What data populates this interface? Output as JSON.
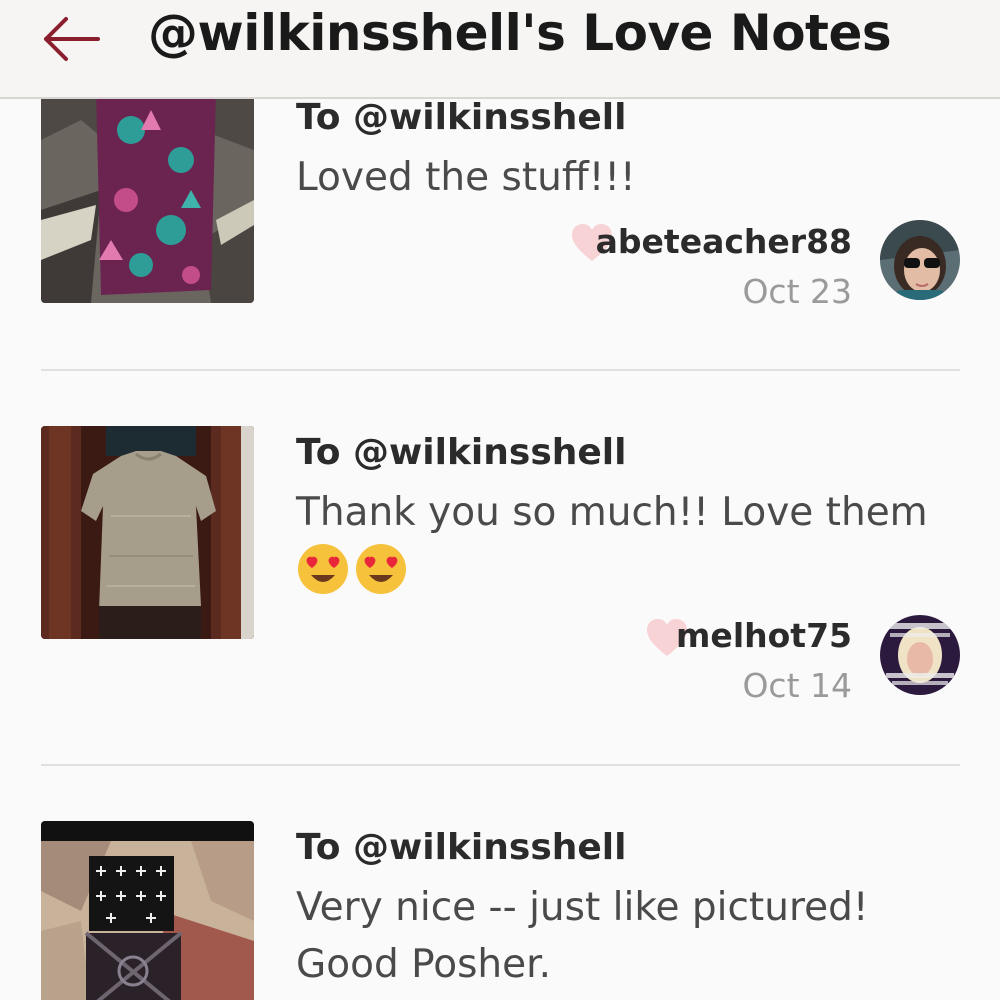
{
  "header": {
    "title": "@wilkinsshell's Love Notes",
    "back_icon": "arrow-left-icon",
    "accent_color": "#8b1e2d"
  },
  "notes": [
    {
      "recipient": "To @wilkinsshell",
      "message": "Loved the stuff!!!",
      "author": "abeteacher88",
      "date": "Oct 23"
    },
    {
      "recipient": "To @wilkinsshell",
      "message": "Thank you so much!! Love them",
      "emojis": [
        "😍",
        "😍"
      ],
      "author": "melhot75",
      "date": "Oct 14"
    },
    {
      "recipient": "To @wilkinsshell",
      "message": "Very nice -- just like pictured! Good Posher."
    }
  ],
  "colors": {
    "heart": "#f8d3d6",
    "divider": "#e1dfdf",
    "date": "#9a9a9a"
  }
}
